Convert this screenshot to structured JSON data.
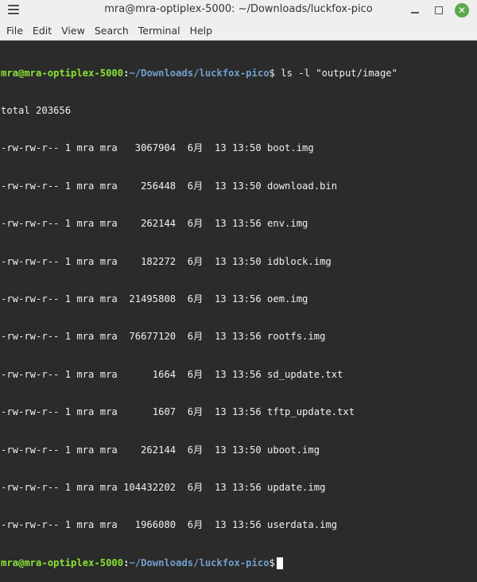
{
  "window": {
    "title": "mra@mra-optiplex-5000: ~/Downloads/luckfox-pico"
  },
  "menu": {
    "items": [
      "File",
      "Edit",
      "View",
      "Search",
      "Terminal",
      "Help"
    ]
  },
  "terminal": {
    "prompt_user": "mra@mra-optiplex-5000",
    "prompt_colon": ":",
    "prompt_path": "~/Downloads/luckfox-pico",
    "prompt_dollar": "$",
    "command": " ls -l \"output/image\"",
    "total_line": "total 203656",
    "listing": [
      "-rw-rw-r-- 1 mra mra   3067904  6月  13 13:50 boot.img",
      "-rw-rw-r-- 1 mra mra    256448  6月  13 13:50 download.bin",
      "-rw-rw-r-- 1 mra mra    262144  6月  13 13:56 env.img",
      "-rw-rw-r-- 1 mra mra    182272  6月  13 13:50 idblock.img",
      "-rw-rw-r-- 1 mra mra  21495808  6月  13 13:56 oem.img",
      "-rw-rw-r-- 1 mra mra  76677120  6月  13 13:56 rootfs.img",
      "-rw-rw-r-- 1 mra mra      1664  6月  13 13:56 sd_update.txt",
      "-rw-rw-r-- 1 mra mra      1607  6月  13 13:56 tftp_update.txt",
      "-rw-rw-r-- 1 mra mra    262144  6月  13 13:50 uboot.img",
      "-rw-rw-r-- 1 mra mra 104432202  6月  13 13:56 update.img",
      "-rw-rw-r-- 1 mra mra   1966080  6月  13 13:56 userdata.img"
    ]
  },
  "icons": {
    "menu": "hamburger-icon",
    "minimize": "minimize-icon",
    "maximize": "maximize-icon",
    "close": "close-icon"
  },
  "colors": {
    "prompt_user": "#8ae234",
    "prompt_path": "#729fcf",
    "background": "#2b2b2b",
    "close_button": "#5aa84a"
  }
}
